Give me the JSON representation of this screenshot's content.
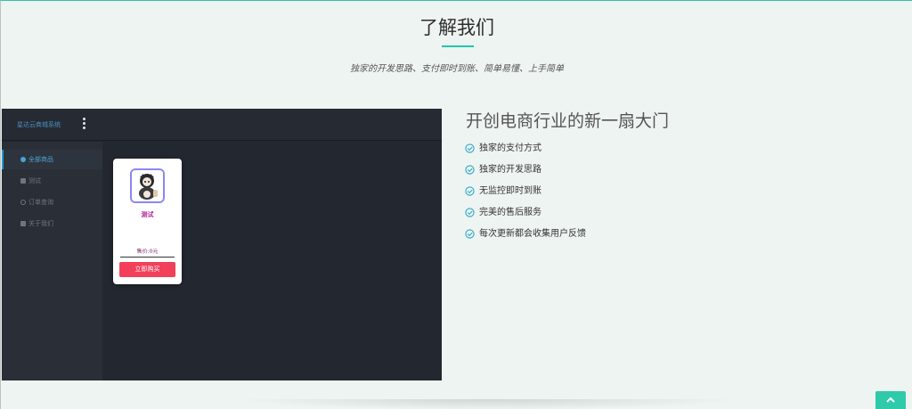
{
  "section": {
    "title": "了解我们",
    "subtitle": "独家的开发思路、支付即时到账、简单易懂、上手简单"
  },
  "app_preview": {
    "brand": "星达云商城系统",
    "menu_icon": "kebab-menu-icon",
    "sidebar": [
      {
        "label": "全部商品",
        "icon": "circle-icon",
        "active": true
      },
      {
        "label": "测试",
        "icon": "grid-icon",
        "active": false
      },
      {
        "label": "订单查询",
        "icon": "search-icon",
        "active": false
      },
      {
        "label": "关于我们",
        "icon": "mail-icon",
        "active": false
      }
    ],
    "product": {
      "name": "测试",
      "price": "售价:0元",
      "buy_label": "立即购买",
      "image_icon": "avatar-image"
    }
  },
  "features": {
    "heading": "开创电商行业的新一扇大门",
    "items": [
      "独家的支付方式",
      "独家的开发思路",
      "无监控即时到账",
      "完美的售后服务",
      "每次更新都会收集用户反馈"
    ],
    "icon": "check-circle-icon"
  },
  "back_to_top": {
    "icon": "chevron-up-icon"
  },
  "colors": {
    "accent": "#1fc8a8",
    "buy_button": "#f23f5a",
    "product_name": "#b4279a"
  }
}
